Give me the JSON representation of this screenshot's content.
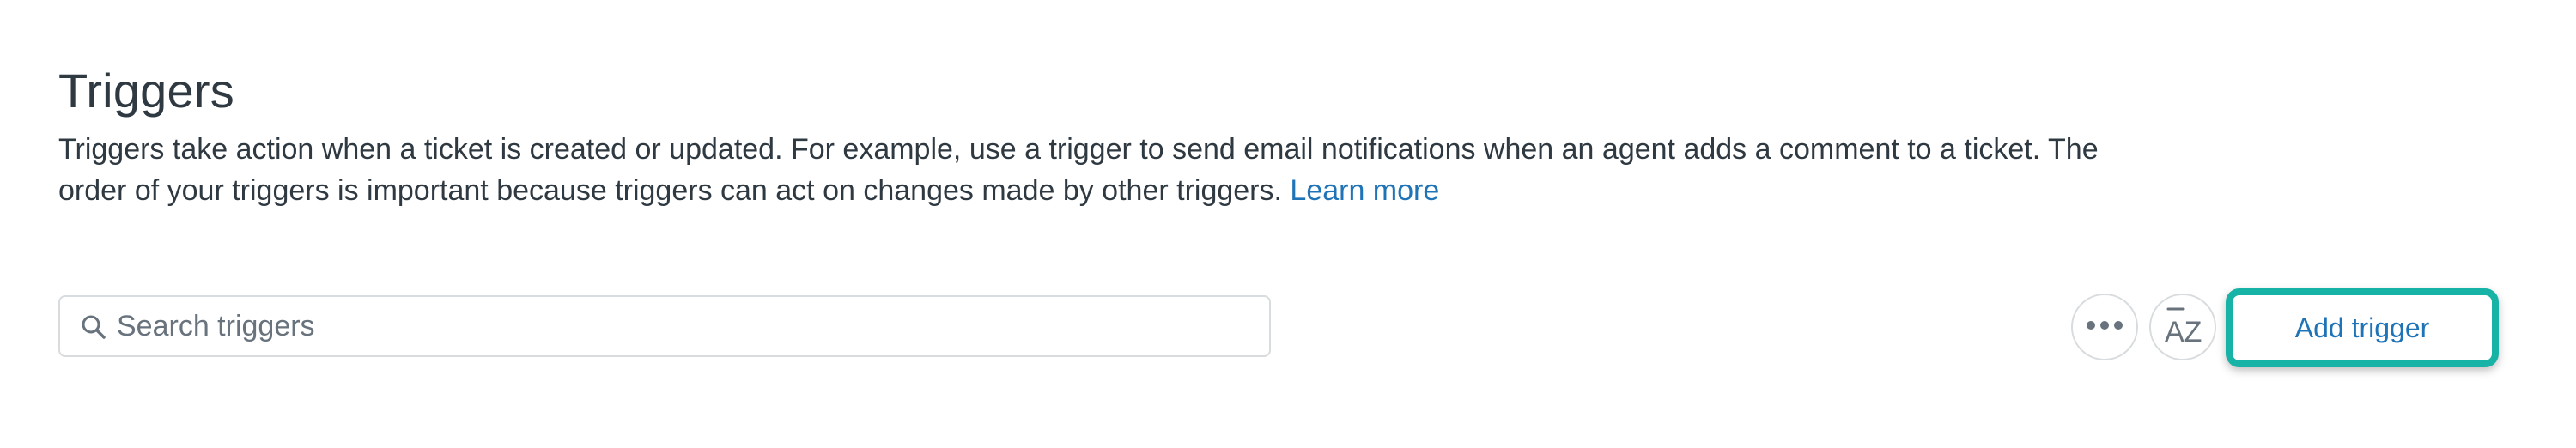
{
  "header": {
    "title": "Triggers",
    "description": "Triggers take action when a ticket is created or updated. For example, use a trigger to send email notifications when an agent adds a comment to a ticket. The order of your triggers is important because triggers can act on changes made by other triggers.",
    "learn_more_label": "Learn more"
  },
  "toolbar": {
    "search": {
      "placeholder": "Search triggers",
      "value": "",
      "icon": "search-icon"
    },
    "more_button": {
      "icon": "more-horizontal-icon"
    },
    "sort_button": {
      "icon": "sort-az-icon",
      "label": "AZ"
    },
    "add_button": {
      "label": "Add trigger"
    }
  },
  "colors": {
    "text": "#2f3941",
    "link": "#1f73b7",
    "border": "#d8dcde",
    "highlight": "#17b3a6",
    "icon": "#68737d"
  }
}
